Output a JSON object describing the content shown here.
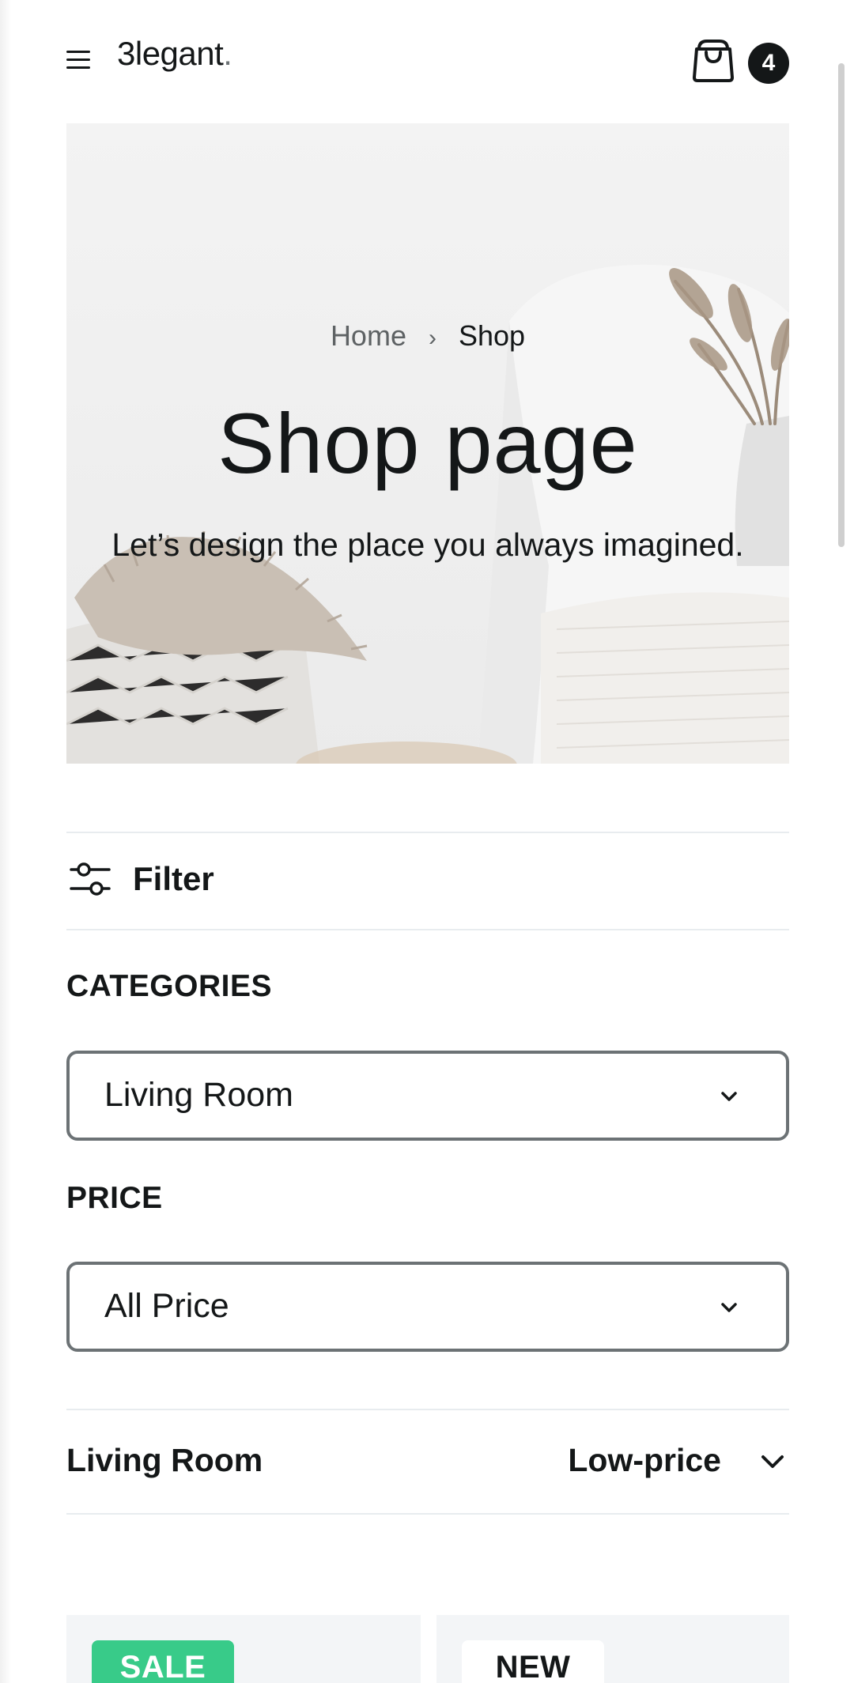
{
  "header": {
    "logo_main": "3legant",
    "logo_dot": ".",
    "cart_count": "4"
  },
  "hero": {
    "breadcrumb_home": "Home",
    "breadcrumb_separator": "›",
    "breadcrumb_current": "Shop",
    "title": "Shop page",
    "subtitle": "Let’s design the place you always imagined."
  },
  "filter": {
    "label": "Filter",
    "categories_heading": "CATEGORIES",
    "categories_selected": "Living Room",
    "price_heading": "PRICE",
    "price_selected": "All Price"
  },
  "sort": {
    "category": "Living Room",
    "order": "Low-price"
  },
  "products": [
    {
      "badge": "SALE"
    },
    {
      "badge": "NEW"
    }
  ],
  "colors": {
    "text_primary": "#141718",
    "text_secondary": "#6c7275",
    "sale_badge": "#38cb89",
    "card_background": "#f3f5f7",
    "divider": "#e8ecef"
  },
  "icons": {
    "menu": "hamburger-menu-icon",
    "cart": "shopping-bag-icon",
    "filter": "sliders-icon",
    "dropdown": "chevron-down-icon"
  }
}
